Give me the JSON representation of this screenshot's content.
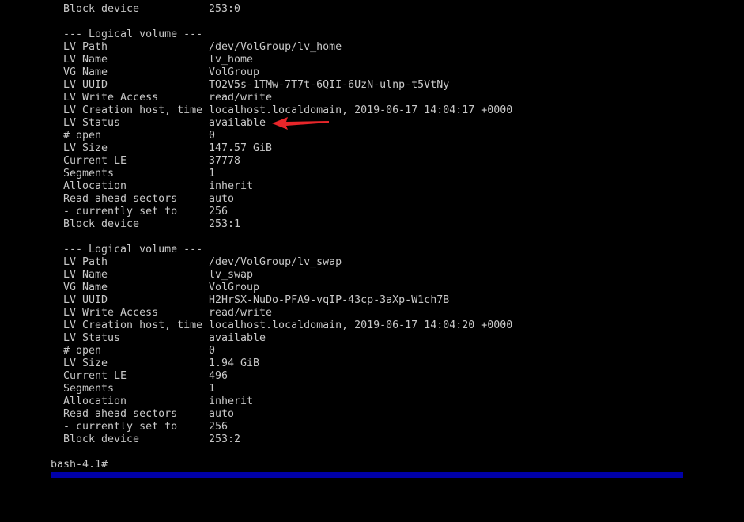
{
  "colors": {
    "background": "#000000",
    "text": "#c8c8c8",
    "cursor_bar": "#0000a8",
    "annotation": "#e8262a"
  },
  "top_line": {
    "key": "Block device",
    "value": "253:0"
  },
  "volumes": [
    {
      "header": "--- Logical volume ---",
      "fields": [
        {
          "key": "LV Path",
          "value": "/dev/VolGroup/lv_home"
        },
        {
          "key": "LV Name",
          "value": "lv_home"
        },
        {
          "key": "VG Name",
          "value": "VolGroup"
        },
        {
          "key": "LV UUID",
          "value": "TO2V5s-1TMw-7T7t-6QII-6UzN-ulnp-t5VtNy"
        },
        {
          "key": "LV Write Access",
          "value": "read/write"
        },
        {
          "key": "LV Creation host, time",
          "value": "localhost.localdomain, 2019-06-17 14:04:17 +0000"
        },
        {
          "key": "LV Status",
          "value": "available"
        },
        {
          "key": "# open",
          "value": "0"
        },
        {
          "key": "LV Size",
          "value": "147.57 GiB"
        },
        {
          "key": "Current LE",
          "value": "37778"
        },
        {
          "key": "Segments",
          "value": "1"
        },
        {
          "key": "Allocation",
          "value": "inherit"
        },
        {
          "key": "Read ahead sectors",
          "value": "auto"
        },
        {
          "key": "- currently set to",
          "value": "256"
        },
        {
          "key": "Block device",
          "value": "253:1"
        }
      ]
    },
    {
      "header": "--- Logical volume ---",
      "fields": [
        {
          "key": "LV Path",
          "value": "/dev/VolGroup/lv_swap"
        },
        {
          "key": "LV Name",
          "value": "lv_swap"
        },
        {
          "key": "VG Name",
          "value": "VolGroup"
        },
        {
          "key": "LV UUID",
          "value": "H2HrSX-NuDo-PFA9-vqIP-43cp-3aXp-W1ch7B"
        },
        {
          "key": "LV Write Access",
          "value": "read/write"
        },
        {
          "key": "LV Creation host, time",
          "value": "localhost.localdomain, 2019-06-17 14:04:20 +0000"
        },
        {
          "key": "LV Status",
          "value": "available"
        },
        {
          "key": "# open",
          "value": "0"
        },
        {
          "key": "LV Size",
          "value": "1.94 GiB"
        },
        {
          "key": "Current LE",
          "value": "496"
        },
        {
          "key": "Segments",
          "value": "1"
        },
        {
          "key": "Allocation",
          "value": "inherit"
        },
        {
          "key": "Read ahead sectors",
          "value": "auto"
        },
        {
          "key": "- currently set to",
          "value": "256"
        },
        {
          "key": "Block device",
          "value": "253:2"
        }
      ]
    }
  ],
  "prompt": "bash-4.1#",
  "annotation": {
    "icon": "red-arrow-icon"
  }
}
